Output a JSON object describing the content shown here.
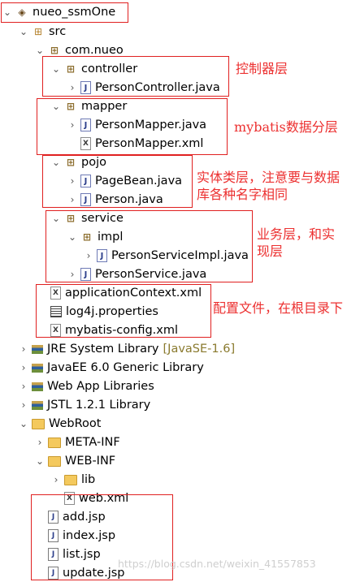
{
  "tree": {
    "project": "nueo_ssmOne",
    "src": "src",
    "base_package": "com.nueo",
    "controller_pkg": "controller",
    "person_controller": "PersonController.java",
    "mapper_pkg": "mapper",
    "person_mapper_java": "PersonMapper.java",
    "person_mapper_xml": "PersonMapper.xml",
    "pojo_pkg": "pojo",
    "page_bean": "PageBean.java",
    "person_java": "Person.java",
    "service_pkg": "service",
    "impl_pkg": "impl",
    "person_service_impl": "PersonServiceImpl.java",
    "person_service": "PersonService.java",
    "application_context": "applicationContext.xml",
    "log4j": "log4j.properties",
    "mybatis_config": "mybatis-config.xml",
    "jre_library": "JRE System Library",
    "jre_version": "[JavaSE-1.6]",
    "javaee_library": "JavaEE 6.0 Generic Library",
    "webapp_libraries": "Web App Libraries",
    "jstl_library": "JSTL 1.2.1 Library",
    "webroot": "WebRoot",
    "meta_inf": "META-INF",
    "web_inf": "WEB-INF",
    "lib": "lib",
    "web_xml": "web.xml",
    "add_jsp": "add.jsp",
    "index_jsp": "index.jsp",
    "list_jsp": "list.jsp",
    "update_jsp": "update.jsp"
  },
  "annotations": {
    "controller": "控制器层",
    "mapper": "mybatis数据分层",
    "pojo": "实体类层，注意要与数据库各种名字相同",
    "service": "业务层，和实现层",
    "config": "配置文件，在根目录下"
  },
  "watermark": "https://blog.csdn.net/weixin_41557853",
  "colors": {
    "annotation_red": "#e02020",
    "library_version": "#8a7a2e"
  }
}
